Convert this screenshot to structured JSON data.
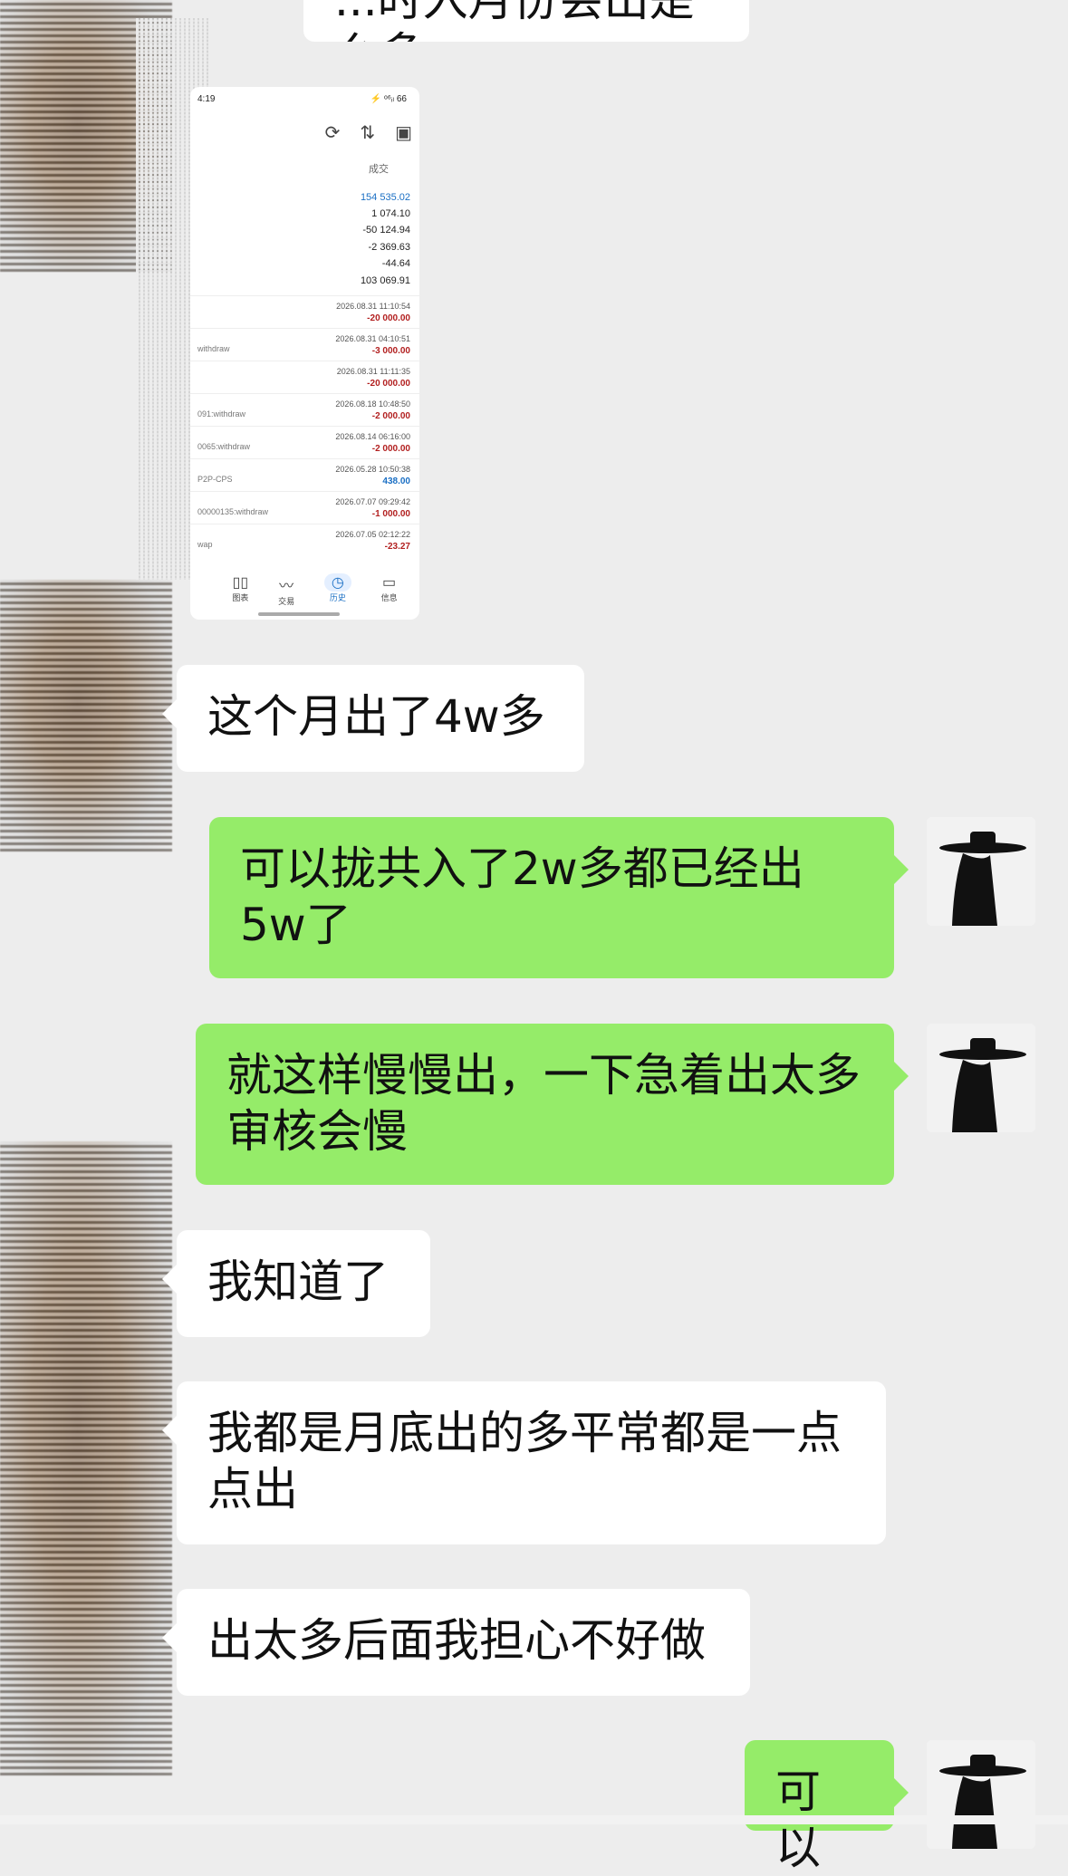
{
  "messages": [
    {
      "side": "left",
      "text": "...时入月份会出是么多",
      "partial": true
    },
    {
      "side": "left",
      "type": "screenshot"
    },
    {
      "side": "left",
      "text": "这个月出了4w多"
    },
    {
      "side": "right",
      "text": "可以拢共入了2w多都已经出5w了"
    },
    {
      "side": "right",
      "text": "就这样慢慢出，一下急着出太多审核会慢"
    },
    {
      "side": "left",
      "text": "我知道了"
    },
    {
      "side": "left",
      "text": "我都是月底出的多平常都是一点点出"
    },
    {
      "side": "left",
      "text": "出太多后面我担心不好做"
    },
    {
      "side": "right",
      "text": "可以",
      "partial": true
    }
  ],
  "screenshot": {
    "status_time": "4:19",
    "status_right": "⚡ ᵒ⁶ᵢₗ 66",
    "toolbar_icons": [
      "sync-icon",
      "sort-icon",
      "calendar-icon"
    ],
    "tab_label": "成交",
    "summary": [
      "154 535.02",
      "1 074.10",
      "-50 124.94",
      "-2 369.63",
      "-44.64",
      "103 069.91"
    ],
    "rows": [
      {
        "date": "2026.08.31 11:10:54",
        "amount": "-20 000.00",
        "label": ""
      },
      {
        "date": "2026.08.31 04:10:51",
        "amount": "-3 000.00",
        "label": "withdraw"
      },
      {
        "date": "2026.08.31 11:11:35",
        "amount": "-20 000.00",
        "label": ""
      },
      {
        "date": "2026.08.18 10:48:50",
        "amount": "-2 000.00",
        "label": "091:withdraw"
      },
      {
        "date": "2026.08.14 06:16:00",
        "amount": "-2 000.00",
        "label": "0065:withdraw"
      },
      {
        "date": "2026.05.28 10:50:38",
        "amount": "438.00",
        "label": "P2P-CPS",
        "positive": true
      },
      {
        "date": "2026.07.07 09:29:42",
        "amount": "-1 000.00",
        "label": "00000135:withdraw"
      },
      {
        "date": "2026.07.05 02:12:22",
        "amount": "-23.27",
        "label": "wap"
      }
    ],
    "nav": [
      {
        "icon": "chart-icon",
        "label": "图表"
      },
      {
        "icon": "trade-icon",
        "label": "交易"
      },
      {
        "icon": "history-icon",
        "label": "历史",
        "active": true
      },
      {
        "icon": "message-icon",
        "label": "信息"
      }
    ]
  }
}
